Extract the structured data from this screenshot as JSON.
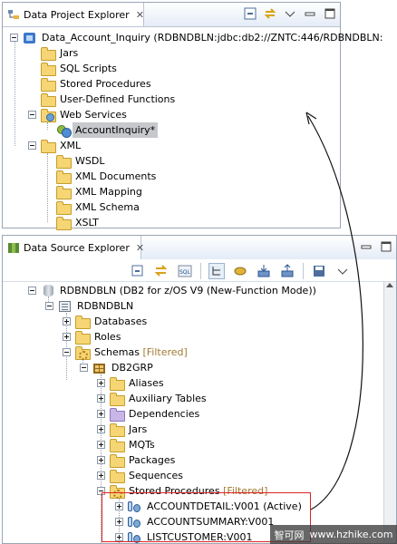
{
  "project_explorer": {
    "tab_label": "Data Project Explorer",
    "items": [
      {
        "label": "Data_Account_Inquiry (RDBNDBLN:jdbc:db2://ZNTC:446/RDBNDBLN:"
      },
      {
        "label": "Jars"
      },
      {
        "label": "SQL Scripts"
      },
      {
        "label": "Stored Procedures"
      },
      {
        "label": "User-Defined Functions"
      },
      {
        "label": "Web Services"
      },
      {
        "label": "AccountInquiry*"
      },
      {
        "label": "XML"
      },
      {
        "label": "WSDL"
      },
      {
        "label": "XML Documents"
      },
      {
        "label": "XML Mapping"
      },
      {
        "label": "XML Schema"
      },
      {
        "label": "XSLT"
      }
    ]
  },
  "source_explorer": {
    "tab_label": "Data Source Explorer",
    "items": [
      {
        "label": "RDBNDBLN (DB2 for z/OS V9 (New-Function Mode))"
      },
      {
        "label": "RDBNDBLN"
      },
      {
        "label": "Databases"
      },
      {
        "label": "Roles"
      },
      {
        "label": "Schemas",
        "filter": "[Filtered]"
      },
      {
        "label": "DB2GRP"
      },
      {
        "label": "Aliases"
      },
      {
        "label": "Auxiliary Tables"
      },
      {
        "label": "Dependencies"
      },
      {
        "label": "Jars"
      },
      {
        "label": "MQTs"
      },
      {
        "label": "Packages"
      },
      {
        "label": "Sequences"
      },
      {
        "label": "Stored Procedures",
        "filter": "[Filtered]"
      },
      {
        "label": "ACCOUNTDETAIL:V001 (Active)"
      },
      {
        "label": "ACCOUNTSUMMARY:V001"
      },
      {
        "label": "LISTCUSTOMER:V001"
      }
    ]
  },
  "watermark": {
    "brand": "智可网",
    "url": "www.hzhike.com"
  },
  "colors": {
    "highlight_box": "#dd2222",
    "selection": "#c6c8cc",
    "filtered_text": "#a17a33"
  }
}
